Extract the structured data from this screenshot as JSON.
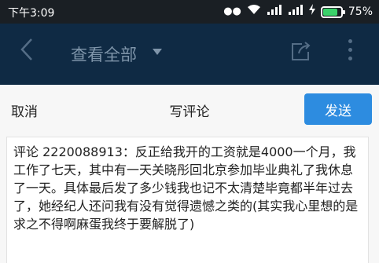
{
  "status_bar": {
    "time": "下午3:09",
    "battery_percent_label": "75%",
    "battery_level": 0.75,
    "icons": [
      "alarm-icon",
      "wifi-icon",
      "signal-icon",
      "signal-icon",
      "charging-icon",
      "battery-icon"
    ]
  },
  "app_bar": {
    "title": "查看全部",
    "icons": [
      "back-icon",
      "dropdown-caret-icon",
      "share-icon",
      "more-icon"
    ],
    "background": "#0f2a44"
  },
  "compose": {
    "cancel_label": "取消",
    "title": "写评论",
    "send_label": "发送",
    "send_color": "#2d8ce0",
    "comment_text": "评论 2220088913：反正给我开的工资就是4000一个月，我工作了七天，其中有一天关晓彤回北京参加毕业典礼了我休息了一天。具体最后发了多少钱我也记不太清楚毕竟都半年过去了，她经纪人还问我有没有觉得遗憾之类的(其实我心里想的是求之不得啊麻蛋我终于要解脱了)"
  }
}
